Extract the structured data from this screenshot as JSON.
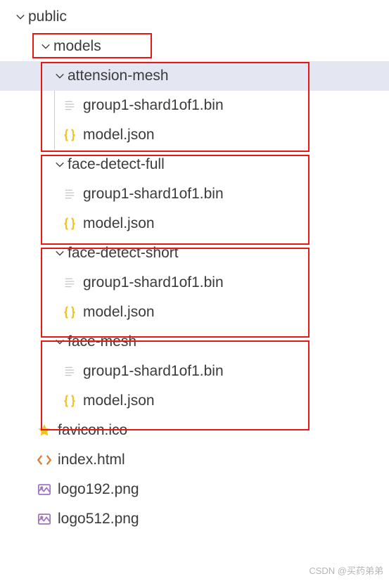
{
  "tree": {
    "public": "public",
    "models": "models",
    "folder1": "attension-mesh",
    "folder2": "face-detect-full",
    "folder3": "face-detect-short",
    "folder4": "face-mesh",
    "bin_file": "group1-shard1of1.bin",
    "json_file": "model.json",
    "favicon": "favicon.ico",
    "index": "index.html",
    "logo192": "logo192.png",
    "logo512": "logo512.png"
  },
  "watermark": "CSDN @买药弟弟"
}
